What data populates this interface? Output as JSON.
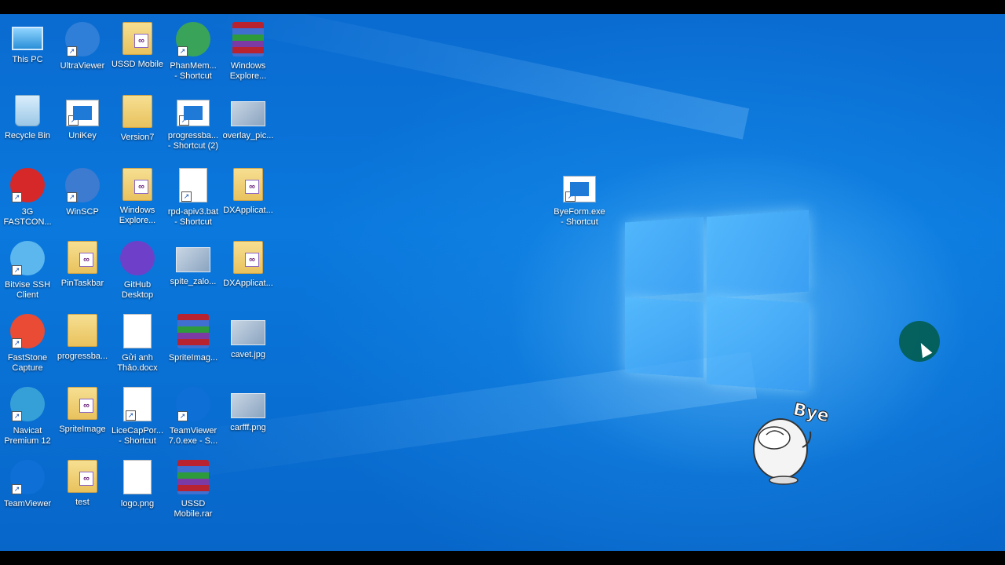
{
  "desktop": {
    "icons": [
      {
        "label": "This PC",
        "icon": "computer-icon"
      },
      {
        "label": "UltraViewer",
        "icon": "ultraviewer-icon"
      },
      {
        "label": "USSD Mobile",
        "icon": "vs-project-folder-icon"
      },
      {
        "label": "PhanMem...\n- Shortcut",
        "icon": "app-shortcut-icon"
      },
      {
        "label": "Windows\nExplore...",
        "icon": "winrar-archive-icon"
      },
      {
        "label": "Recycle Bin",
        "icon": "recycle-bin-icon"
      },
      {
        "label": "UniKey",
        "icon": "unikey-icon"
      },
      {
        "label": "Version7",
        "icon": "folder-icon"
      },
      {
        "label": "progressba...\n- Shortcut (2)",
        "icon": "window-app-icon"
      },
      {
        "label": "overlay_pic...",
        "icon": "image-file-icon"
      },
      {
        "label": "3G\nFASTCON...",
        "icon": "fastcon-icon"
      },
      {
        "label": "WinSCP",
        "icon": "winscp-icon"
      },
      {
        "label": "Windows\nExplore...",
        "icon": "vs-project-folder-icon"
      },
      {
        "label": "rpd-apiv3.bat\n- Shortcut",
        "icon": "batch-file-icon"
      },
      {
        "label": "DXApplicat...",
        "icon": "vs-project-folder-icon"
      },
      {
        "label": "Bitvise SSH\nClient",
        "icon": "bitvise-icon"
      },
      {
        "label": "PinTaskbar",
        "icon": "vs-project-folder-icon"
      },
      {
        "label": "GitHub\nDesktop",
        "icon": "github-icon"
      },
      {
        "label": "spite_zalo...",
        "icon": "image-file-icon"
      },
      {
        "label": "DXApplicat...",
        "icon": "vs-project-folder-icon"
      },
      {
        "label": "FastStone\nCapture",
        "icon": "faststone-icon"
      },
      {
        "label": "progressba...",
        "icon": "folder-icon"
      },
      {
        "label": "Gửi anh\nThảo.docx",
        "icon": "word-document-icon"
      },
      {
        "label": "SpriteImag...",
        "icon": "winrar-archive-icon"
      },
      {
        "label": "cavet.jpg",
        "icon": "image-file-icon"
      },
      {
        "label": "Navicat\nPremium 12",
        "icon": "navicat-icon"
      },
      {
        "label": "SpriteImage",
        "icon": "vs-project-folder-icon"
      },
      {
        "label": "LiceCapPor...\n- Shortcut",
        "icon": "licecap-icon"
      },
      {
        "label": "TeamViewer\n7.0.exe - S...",
        "icon": "teamviewer-icon"
      },
      {
        "label": "carfff.png",
        "icon": "image-file-icon"
      },
      {
        "label": "TeamViewer",
        "icon": "teamviewer-icon"
      },
      {
        "label": "test",
        "icon": "vs-project-folder-icon"
      },
      {
        "label": "logo.png",
        "icon": "logo-image-icon"
      },
      {
        "label": "USSD\nMobile.rar",
        "icon": "winrar-archive-icon"
      }
    ],
    "byeform": {
      "label": "ByeForm.exe\n- Shortcut",
      "icon": "window-app-icon"
    },
    "sticker_text": "Bye"
  }
}
